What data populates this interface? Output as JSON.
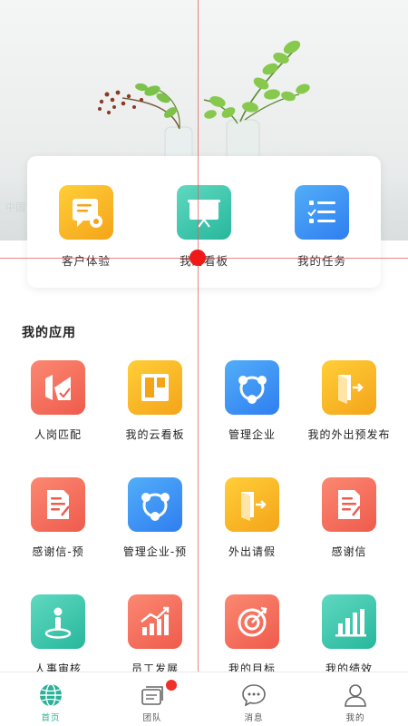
{
  "banner": {
    "text": "中国"
  },
  "quick_actions": [
    {
      "label": "客户体验",
      "icon": "feedback-doc-icon",
      "color": "#f7b51f"
    },
    {
      "label": "我的看板",
      "icon": "presentation-board-icon",
      "color": "#2fbf9f"
    },
    {
      "label": "我的任务",
      "icon": "task-list-icon",
      "color": "#3a8ff5"
    }
  ],
  "section_title": "我的应用",
  "apps": [
    {
      "label": "人岗匹配",
      "icon": "job-match-icon",
      "color": "red"
    },
    {
      "label": "我的云看板",
      "icon": "cloud-board-icon",
      "color": "yellow"
    },
    {
      "label": "管理企业",
      "icon": "share-nodes-icon",
      "color": "blue"
    },
    {
      "label": "我的外出预发布",
      "icon": "door-exit-icon",
      "color": "yellow"
    },
    {
      "label": "感谢信-预",
      "icon": "letter-doc-icon",
      "color": "red"
    },
    {
      "label": "管理企业-预",
      "icon": "share-nodes-icon",
      "color": "blue"
    },
    {
      "label": "外出请假",
      "icon": "door-exit-icon",
      "color": "yellow"
    },
    {
      "label": "感谢信",
      "icon": "letter-doc-icon",
      "color": "red"
    },
    {
      "label": "人事审核",
      "icon": "person-pin-icon",
      "color": "green"
    },
    {
      "label": "员工发展",
      "icon": "growth-chart-icon",
      "color": "red"
    },
    {
      "label": "我的目标",
      "icon": "target-icon",
      "color": "red"
    },
    {
      "label": "我的绩效",
      "icon": "bar-chart-icon",
      "color": "green"
    }
  ],
  "tabs": [
    {
      "label": "首页",
      "icon": "globe-icon",
      "active": true
    },
    {
      "label": "团队",
      "icon": "team-cards-icon",
      "badge": true
    },
    {
      "label": "消息",
      "icon": "chat-bubble-icon"
    },
    {
      "label": "我的",
      "icon": "user-icon"
    }
  ],
  "colors": {
    "accent": "#2ab19a",
    "badge": "#f0302a",
    "guide": "#e45b5b"
  }
}
